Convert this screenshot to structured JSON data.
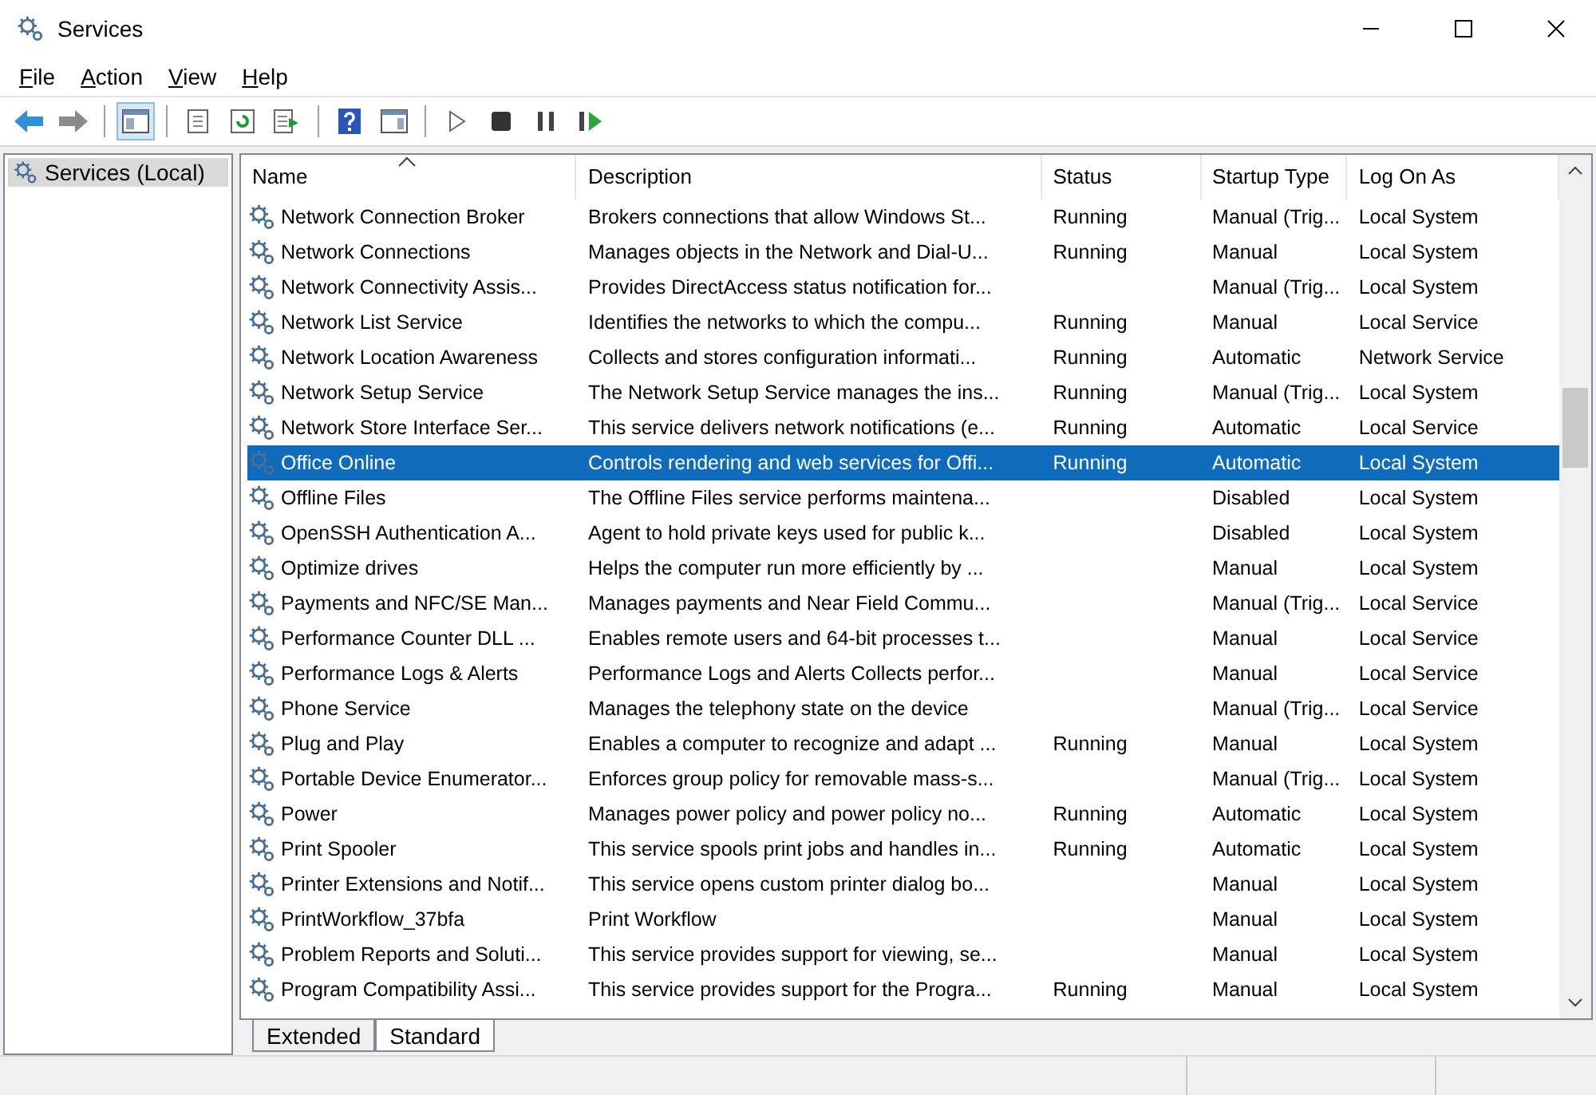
{
  "window": {
    "title": "Services"
  },
  "menu": [
    {
      "label": "File"
    },
    {
      "label": "Action"
    },
    {
      "label": "View"
    },
    {
      "label": "Help"
    }
  ],
  "tree": [
    {
      "label": "Services (Local)",
      "selected": true
    }
  ],
  "columns": [
    {
      "label": "Name",
      "sorted": true
    },
    {
      "label": "Description",
      "sorted": false
    },
    {
      "label": "Status",
      "sorted": false
    },
    {
      "label": "Startup Type",
      "sorted": false
    },
    {
      "label": "Log On As",
      "sorted": false
    }
  ],
  "rows": [
    {
      "name": "Network Connection Broker",
      "description": "Brokers connections that allow Windows St...",
      "status": "Running",
      "startup": "Manual (Trig...",
      "logon": "Local System",
      "selected": false
    },
    {
      "name": "Network Connections",
      "description": "Manages objects in the Network and Dial-U...",
      "status": "Running",
      "startup": "Manual",
      "logon": "Local System",
      "selected": false
    },
    {
      "name": "Network Connectivity Assis...",
      "description": "Provides DirectAccess status notification for...",
      "startup": "Manual (Trig...",
      "logon": "Local System",
      "selected": false
    },
    {
      "name": "Network List Service",
      "description": "Identifies the networks to which the compu...",
      "status": "Running",
      "startup": "Manual",
      "logon": "Local Service",
      "selected": false
    },
    {
      "name": "Network Location Awareness",
      "description": "Collects and stores configuration informati...",
      "status": "Running",
      "startup": "Automatic",
      "logon": "Network Service",
      "selected": false
    },
    {
      "name": "Network Setup Service",
      "description": "The Network Setup Service manages the ins...",
      "status": "Running",
      "startup": "Manual (Trig...",
      "logon": "Local System",
      "selected": false
    },
    {
      "name": "Network Store Interface Ser...",
      "description": "This service delivers network notifications (e...",
      "status": "Running",
      "startup": "Automatic",
      "logon": "Local Service",
      "selected": false
    },
    {
      "name": "Office Online",
      "description": "Controls rendering and web services for Offi...",
      "status": "Running",
      "startup": "Automatic",
      "logon": "Local System",
      "selected": true
    },
    {
      "name": "Offline Files",
      "description": "The Offline Files service performs maintena...",
      "startup": "Disabled",
      "logon": "Local System",
      "selected": false
    },
    {
      "name": "OpenSSH Authentication A...",
      "description": "Agent to hold private keys used for public k...",
      "startup": "Disabled",
      "logon": "Local System",
      "selected": false
    },
    {
      "name": "Optimize drives",
      "description": "Helps the computer run more efficiently by ...",
      "startup": "Manual",
      "logon": "Local System",
      "selected": false
    },
    {
      "name": "Payments and NFC/SE Man...",
      "description": "Manages payments and Near Field Commu...",
      "startup": "Manual (Trig...",
      "logon": "Local Service",
      "selected": false
    },
    {
      "name": "Performance Counter DLL ...",
      "description": "Enables remote users and 64-bit processes t...",
      "startup": "Manual",
      "logon": "Local Service",
      "selected": false
    },
    {
      "name": "Performance Logs & Alerts",
      "description": "Performance Logs and Alerts Collects perfor...",
      "startup": "Manual",
      "logon": "Local Service",
      "selected": false
    },
    {
      "name": "Phone Service",
      "description": "Manages the telephony state on the device",
      "startup": "Manual (Trig...",
      "logon": "Local Service",
      "selected": false
    },
    {
      "name": "Plug and Play",
      "description": "Enables a computer to recognize and adapt ...",
      "status": "Running",
      "startup": "Manual",
      "logon": "Local System",
      "selected": false
    },
    {
      "name": "Portable Device Enumerator...",
      "description": "Enforces group policy for removable mass-s...",
      "startup": "Manual (Trig...",
      "logon": "Local System",
      "selected": false
    },
    {
      "name": "Power",
      "description": "Manages power policy and power policy no...",
      "status": "Running",
      "startup": "Automatic",
      "logon": "Local System",
      "selected": false
    },
    {
      "name": "Print Spooler",
      "description": "This service spools print jobs and handles in...",
      "status": "Running",
      "startup": "Automatic",
      "logon": "Local System",
      "selected": false
    },
    {
      "name": "Printer Extensions and Notif...",
      "description": "This service opens custom printer dialog bo...",
      "startup": "Manual",
      "logon": "Local System",
      "selected": false
    },
    {
      "name": "PrintWorkflow_37bfa",
      "description": "Print Workflow",
      "startup": "Manual",
      "logon": "Local System",
      "selected": false
    },
    {
      "name": "Problem Reports and Soluti...",
      "description": "This service provides support for viewing, se...",
      "startup": "Manual",
      "logon": "Local System",
      "selected": false
    },
    {
      "name": "Program Compatibility Assi...",
      "description": "This service provides support for the Progra...",
      "status": "Running",
      "startup": "Manual",
      "logon": "Local System",
      "selected": false
    }
  ],
  "view_tabs": [
    {
      "label": "Extended",
      "selected": false
    },
    {
      "label": "Standard",
      "selected": true
    }
  ]
}
